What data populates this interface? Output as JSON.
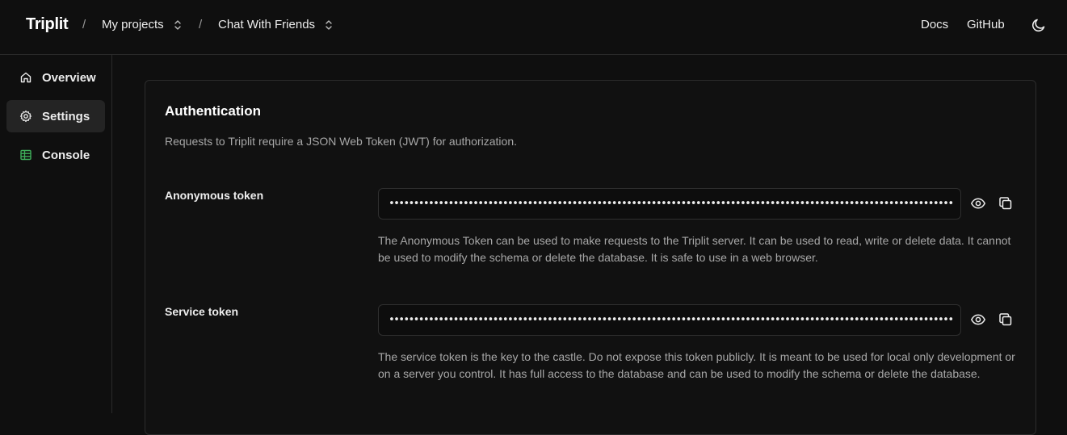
{
  "header": {
    "brand": "Triplit",
    "separator": "/",
    "project_selector": "My projects",
    "app_selector": "Chat With Friends",
    "docs_link": "Docs",
    "github_link": "GitHub",
    "theme_toggle_icon": "moon-icon"
  },
  "sidebar": {
    "items": [
      {
        "label": "Overview",
        "icon": "home-icon",
        "active": false
      },
      {
        "label": "Settings",
        "icon": "gear-icon",
        "active": true
      },
      {
        "label": "Console",
        "icon": "table-icon",
        "active": false
      }
    ]
  },
  "auth": {
    "title": "Authentication",
    "description": "Requests to Triplit require a JSON Web Token (JWT) for authorization.",
    "anonymous": {
      "label": "Anonymous token",
      "value": "••••••••••••••••••••••••••••••••••••••••••••••••••••••••••••••••••••••••••••••••••••••••••••••••••••••••••••••••••",
      "help": "The Anonymous Token can be used to make requests to the Triplit server. It can be used to read, write or delete data. It cannot be used to modify the schema or delete the database. It is safe to use in a web browser."
    },
    "service": {
      "label": "Service token",
      "value": "••••••••••••••••••••••••••••••••••••••••••••••••••••••••••••••••••••••••••••••••••••••••••••••••••••••••••••••••••",
      "help": "The service token is the key to the castle. Do not expose this token publicly. It is meant to be used for local only development or on a server you control. It has full access to the database and can be used to modify the schema or delete the database."
    }
  },
  "colors": {
    "background": "#0f0f0f",
    "console_icon": "#3fae5a",
    "muted_text": "#a7a7a7"
  }
}
